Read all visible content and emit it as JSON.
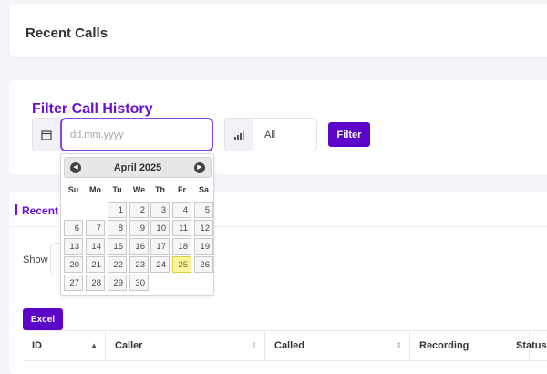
{
  "header": {
    "title": "Recent Calls"
  },
  "filter": {
    "title": "Filter Call History",
    "date_placeholder": "dd.mm.yyyy",
    "type_value": "All",
    "button_label": "Filter"
  },
  "datepicker": {
    "month_label": "April 2025",
    "weekdays": [
      "Su",
      "Mo",
      "Tu",
      "We",
      "Th",
      "Fr",
      "Sa"
    ],
    "days": [
      "1",
      "2",
      "3",
      "4",
      "5",
      "6",
      "7",
      "8",
      "9",
      "10",
      "11",
      "12",
      "13",
      "14",
      "15",
      "16",
      "17",
      "18",
      "19",
      "20",
      "21",
      "22",
      "23",
      "24",
      "25",
      "26",
      "27",
      "28",
      "29",
      "30"
    ],
    "today": "25"
  },
  "recent": {
    "title": "Recent",
    "show_label": "Show",
    "excel_label": "Excel",
    "columns": [
      "ID",
      "Caller",
      "Called",
      "Recording",
      "Status"
    ]
  },
  "colors": {
    "accent": "#6a0fd6",
    "button": "#5c06c9",
    "today_bg": "#fcf59c"
  }
}
